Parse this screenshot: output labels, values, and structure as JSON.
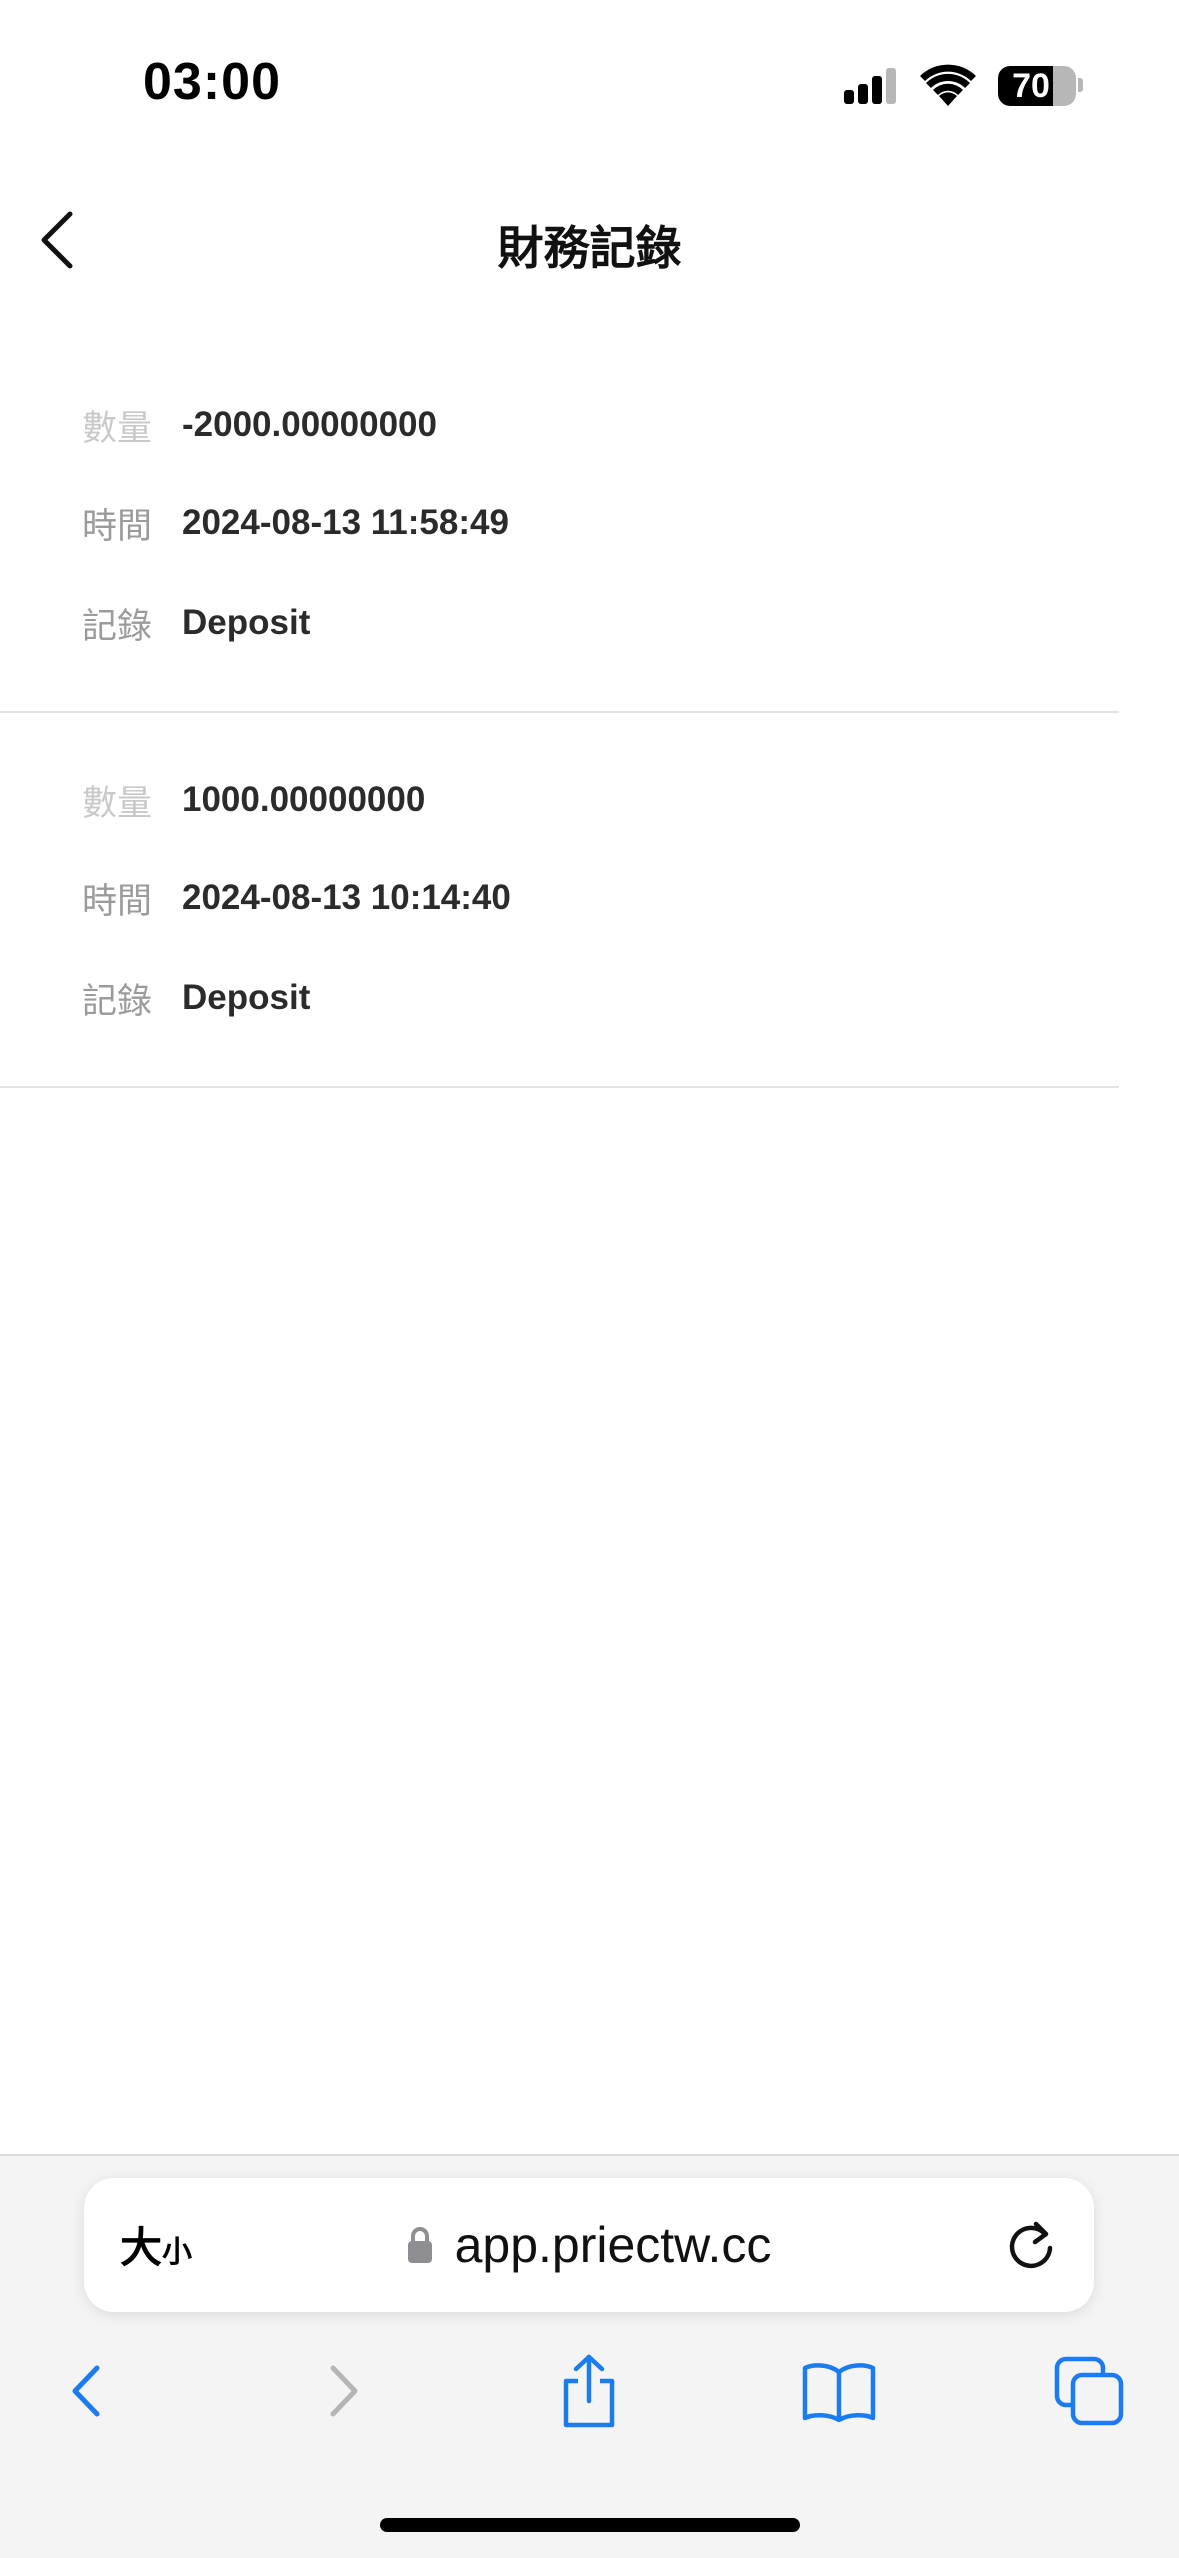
{
  "status_bar": {
    "time": "03:00",
    "battery_percent": "70",
    "battery_level": 0.7,
    "icons": [
      "cellular-signal-icon",
      "wifi-icon",
      "battery-icon"
    ]
  },
  "header": {
    "title": "財務記錄",
    "back_icon": "chevron-left-icon"
  },
  "records": [
    {
      "amount_label": "數量",
      "amount": "-2000.00000000",
      "time_label": "時間",
      "time": "2024-08-13 11:58:49",
      "record_label": "記錄",
      "record": "Deposit"
    },
    {
      "amount_label": "數量",
      "amount": "1000.00000000",
      "time_label": "時間",
      "time": "2024-08-13 10:14:40",
      "record_label": "記錄",
      "record": "Deposit"
    }
  ],
  "browser": {
    "text_size_big": "大",
    "text_size_small": "小",
    "url": "app.priectw.cc",
    "accent_color": "#1a7cf0",
    "toolbar_icons": [
      "back-icon",
      "forward-icon",
      "share-icon",
      "bookmarks-icon",
      "tabs-icon"
    ]
  }
}
